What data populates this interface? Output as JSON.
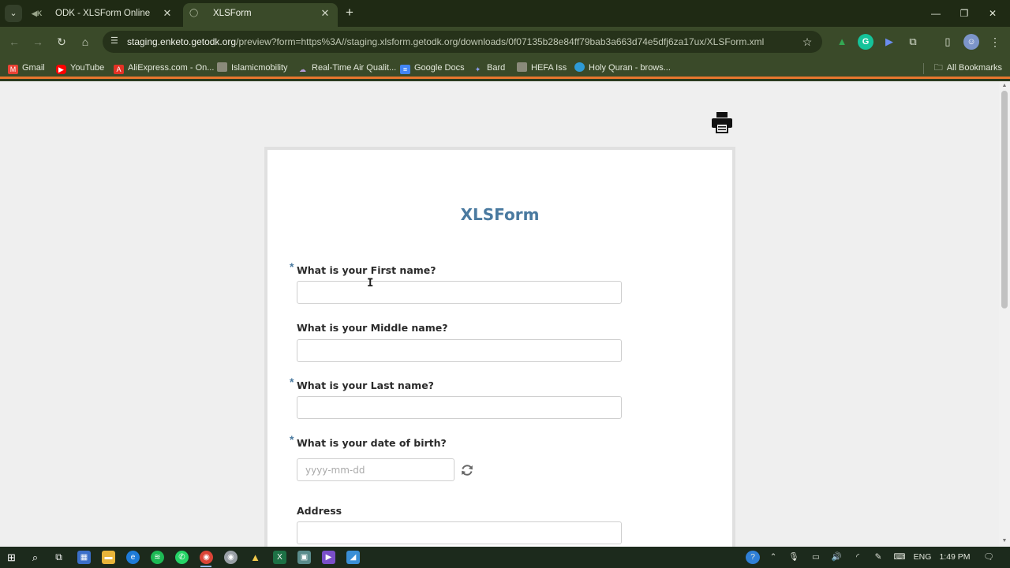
{
  "browser": {
    "tabs": [
      {
        "label": "ODK - XLSForm Online",
        "favicon": "odk-icon",
        "active": false
      },
      {
        "label": "XLSForm",
        "favicon": "globe-icon",
        "active": true
      }
    ],
    "url_prefix": "staging.enketo.getodk.org",
    "url_rest": "/preview?form=https%3A//staging.xlsform.getodk.org/downloads/0f07135b28e84ff79bab3a663d74e5dfj6za17ux/XLSForm.xml",
    "bookmarks": [
      {
        "label": "Gmail",
        "icon": "gmail-icon",
        "color": "#ea4335"
      },
      {
        "label": "YouTube",
        "icon": "youtube-icon",
        "color": "#ff0000"
      },
      {
        "label": "AliExpress.com - On...",
        "icon": "aliexpress-icon",
        "color": "#e43225"
      },
      {
        "label": "Islamicmobility",
        "icon": "page-icon",
        "color": "#8a8a7a"
      },
      {
        "label": "Real-Time Air Qualit...",
        "icon": "cloud-icon",
        "color": "#9a86b8"
      },
      {
        "label": "Google Docs",
        "icon": "docs-icon",
        "color": "#4285f4"
      },
      {
        "label": "Bard",
        "icon": "sparkle-icon",
        "color": "#7b8ef0"
      },
      {
        "label": "HEFA Iss",
        "icon": "page-icon",
        "color": "#8a8a7a"
      },
      {
        "label": "Holy Quran - brows...",
        "icon": "quran-icon",
        "color": "#2e9bd6"
      }
    ],
    "all_bookmarks": "All Bookmarks"
  },
  "form": {
    "title": "XLSForm",
    "questions": [
      {
        "label": "What is your First name?",
        "required": true,
        "value": "",
        "placeholder": ""
      },
      {
        "label": "What is your Middle name?",
        "required": false,
        "value": "",
        "placeholder": ""
      },
      {
        "label": "What is your Last name?",
        "required": true,
        "value": "",
        "placeholder": ""
      },
      {
        "label": "What is your date of birth?",
        "required": true,
        "value": "",
        "placeholder": "yyyy-mm-dd"
      },
      {
        "label": "Address",
        "required": false,
        "value": "",
        "placeholder": ""
      }
    ],
    "required_marker": "*"
  },
  "taskbar": {
    "language": "ENG",
    "time": "1:49 PM"
  },
  "colors": {
    "accent": "#4a7aa0",
    "browser_frame": "#3a4a29",
    "loading_bar": "#e8772e"
  }
}
